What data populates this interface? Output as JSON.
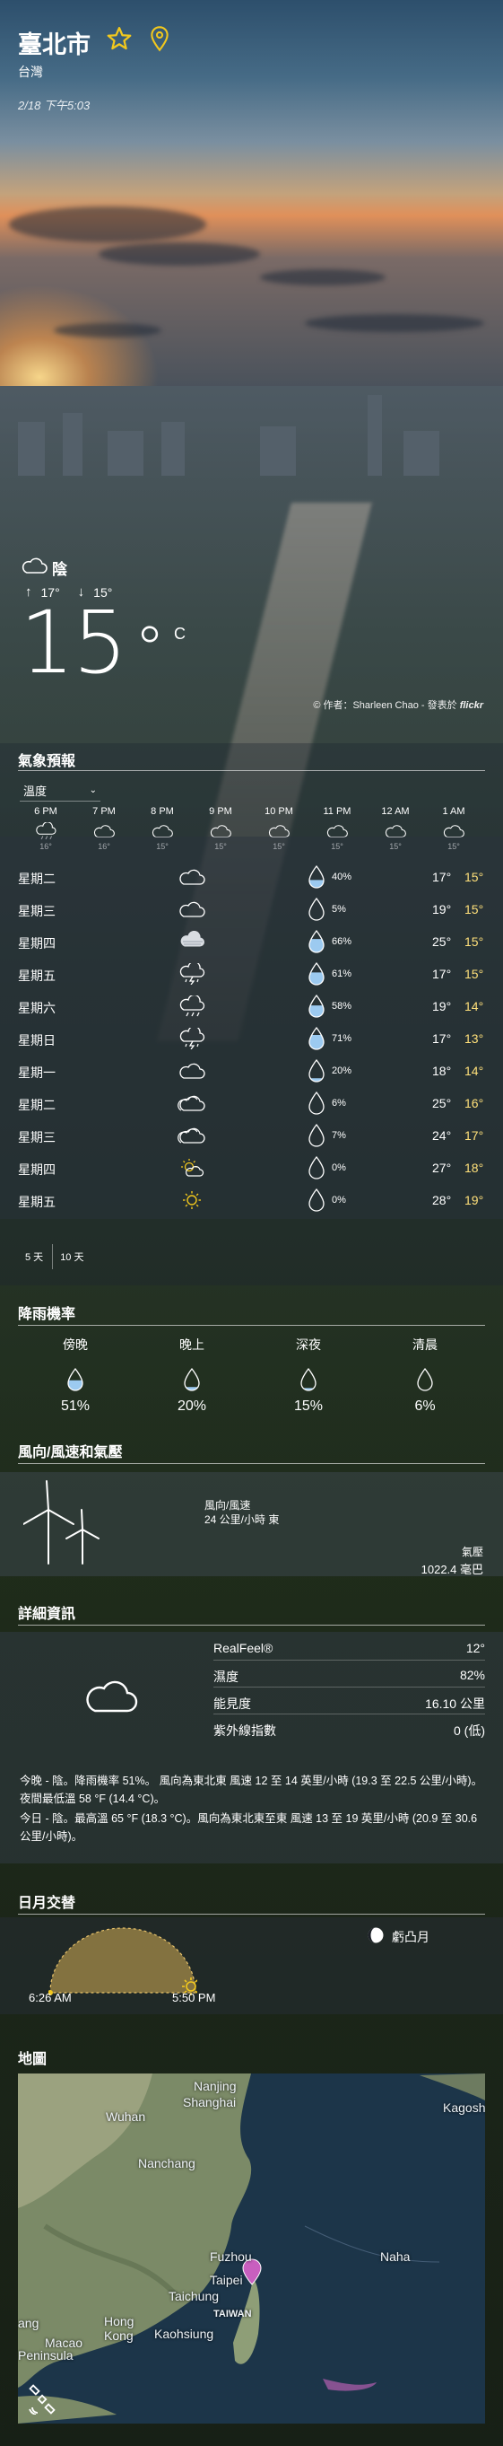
{
  "header": {
    "city": "臺北市",
    "country": "台灣",
    "datetime": "2/18  下午5:03"
  },
  "current": {
    "condition": "陰",
    "high": "17°",
    "low": "15°",
    "temp": "15",
    "degree": "°",
    "unit": "C",
    "photo_credit_prefix": "© 作者：Sharleen Chao - 發表於",
    "photo_credit_brand": "flickr"
  },
  "forecast": {
    "title": "氣象預報",
    "selector": "溫度",
    "hourly": [
      {
        "time": "6 PM",
        "icon": "cloud-rain-icon",
        "temp": "16°"
      },
      {
        "time": "7 PM",
        "icon": "cloud-icon",
        "temp": "16°"
      },
      {
        "time": "8 PM",
        "icon": "cloud-icon",
        "temp": "15°"
      },
      {
        "time": "9 PM",
        "icon": "cloud-icon",
        "temp": "15°"
      },
      {
        "time": "10 PM",
        "icon": "cloud-icon",
        "temp": "15°"
      },
      {
        "time": "11 PM",
        "icon": "cloud-icon",
        "temp": "15°"
      },
      {
        "time": "12 AM",
        "icon": "cloud-icon",
        "temp": "15°"
      },
      {
        "time": "1 AM",
        "icon": "cloud-icon",
        "temp": "15°"
      }
    ],
    "daily": [
      {
        "day": "星期二",
        "icon": "cloud-icon",
        "precip": "40%",
        "high": "17°",
        "low": "15°"
      },
      {
        "day": "星期三",
        "icon": "cloud-icon",
        "precip": "5%",
        "high": "19°",
        "low": "15°"
      },
      {
        "day": "星期四",
        "icon": "fog-cloud-icon",
        "precip": "66%",
        "high": "25°",
        "low": "15°"
      },
      {
        "day": "星期五",
        "icon": "thunderstorm-icon",
        "precip": "61%",
        "high": "17°",
        "low": "15°"
      },
      {
        "day": "星期六",
        "icon": "cloud-rain-icon",
        "precip": "58%",
        "high": "19°",
        "low": "14°"
      },
      {
        "day": "星期日",
        "icon": "thunderstorm-icon",
        "precip": "71%",
        "high": "17°",
        "low": "13°"
      },
      {
        "day": "星期一",
        "icon": "cloud-icon",
        "precip": "20%",
        "high": "18°",
        "low": "14°"
      },
      {
        "day": "星期二",
        "icon": "partly-cloudy-icon",
        "precip": "6%",
        "high": "25°",
        "low": "16°"
      },
      {
        "day": "星期三",
        "icon": "partly-cloudy-icon",
        "precip": "7%",
        "high": "24°",
        "low": "17°"
      },
      {
        "day": "星期四",
        "icon": "sun-cloud-icon",
        "precip": "0%",
        "high": "27°",
        "low": "18°"
      },
      {
        "day": "星期五",
        "icon": "sun-icon",
        "precip": "0%",
        "high": "28°",
        "low": "19°"
      }
    ],
    "tab_5": "5 天",
    "tab_10": "10 天"
  },
  "precipitation": {
    "title": "降雨機率",
    "items": [
      {
        "label": "傍晚",
        "value": "51%"
      },
      {
        "label": "晚上",
        "value": "20%"
      },
      {
        "label": "深夜",
        "value": "15%"
      },
      {
        "label": "清晨",
        "value": "6%"
      }
    ]
  },
  "wind": {
    "title": "風向/風速和氣壓",
    "label": "風向/風速",
    "value": "24 公里/小時 東",
    "pressure_label": "氣壓",
    "pressure_value": "1022.4 毫巴"
  },
  "details": {
    "title": "詳細資訊",
    "rows": [
      {
        "label": "RealFeel®",
        "value": "12°"
      },
      {
        "label": "濕度",
        "value": "82%"
      },
      {
        "label": "能見度",
        "value": "16.10 公里"
      },
      {
        "label": "紫外線指數",
        "value": "0 (低)"
      }
    ],
    "tonight": "今晚 - 陰。降雨機率 51%。 風向為東北東 風速 12 至 14 英里/小時 (19.3 至 22.5 公里/小時)。 夜間最低溫 58 °F (14.4 °C)。",
    "today": "今日 - 陰。最高溫 65 °F (18.3 °C)。風向為東北東至東 風速 13 至 19 英里/小時 (20.9 至 30.6 公里/小時)。"
  },
  "sun": {
    "title": "日月交替",
    "sunrise": "6:26 AM",
    "sunset": "5:50 PM",
    "moon": "虧凸月"
  },
  "map": {
    "title": "地圖",
    "labels": [
      "Nanjing",
      "Shanghai",
      "Wuhan",
      "Kagoshi",
      "Nanchang",
      "Fuzhou",
      "Naha",
      "Taipei",
      "Taichung",
      "TAIWAN",
      "ang",
      "Hong Kong",
      "Kaohsiung",
      "Macao",
      "Peninsula"
    ]
  }
}
